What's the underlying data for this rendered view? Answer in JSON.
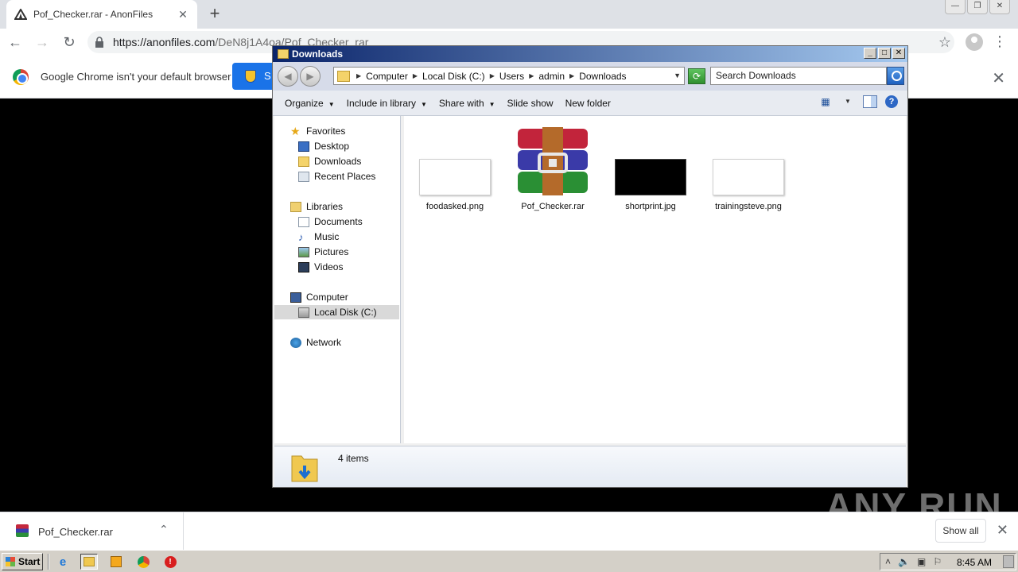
{
  "browser": {
    "tab_title": "Pof_Checker.rar - AnonFiles",
    "url_host": "https://anonfiles.com",
    "url_path": "/DeN8j1A4oa/Pof_Checker_rar",
    "infobar_text": "Google Chrome isn't your default browser",
    "infobar_button": "S"
  },
  "explorer": {
    "title": "Downloads",
    "breadcrumbs": [
      "Computer",
      "Local Disk (C:)",
      "Users",
      "admin",
      "Downloads"
    ],
    "search_placeholder": "Search Downloads",
    "commands": [
      {
        "label": "Organize",
        "dropdown": true
      },
      {
        "label": "Include in library",
        "dropdown": true
      },
      {
        "label": "Share with",
        "dropdown": true
      },
      {
        "label": "Slide show",
        "dropdown": false
      },
      {
        "label": "New folder",
        "dropdown": false
      }
    ],
    "nav": {
      "favorites": "Favorites",
      "desktop": "Desktop",
      "downloads": "Downloads",
      "recent": "Recent Places",
      "libraries": "Libraries",
      "documents": "Documents",
      "music": "Music",
      "pictures": "Pictures",
      "videos": "Videos",
      "computer": "Computer",
      "local_disk": "Local Disk (C:)",
      "network": "Network"
    },
    "files": [
      {
        "name": "foodasked.png",
        "type": "image-white"
      },
      {
        "name": "Pof_Checker.rar",
        "type": "winrar"
      },
      {
        "name": "shortprint.jpg",
        "type": "image-black"
      },
      {
        "name": "trainingsteve.png",
        "type": "image-white"
      }
    ],
    "status": "4 items"
  },
  "download_bar": {
    "file": "Pof_Checker.rar",
    "show_all": "Show all"
  },
  "watermark": "ANY RUN",
  "taskbar": {
    "start": "Start",
    "time": "8:45 AM"
  }
}
